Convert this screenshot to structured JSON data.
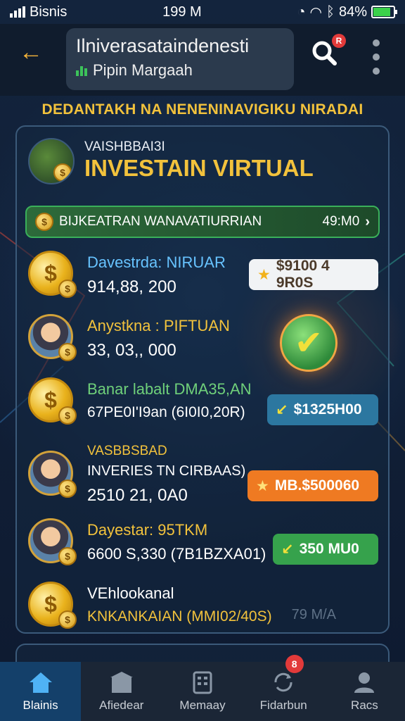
{
  "status_bar": {
    "carrier": "Bisnis",
    "time": "199 M",
    "battery": "84%",
    "battery_level": 0.84
  },
  "header": {
    "title": "Ilniverasataindenesti",
    "subtitle": "Pipin Margaah",
    "search_badge": "R"
  },
  "banner": "DEDANTAKH NA NENENINAVIGIKU NIRADAI",
  "card": {
    "kicker": "VAISHBBAI3I",
    "title": "INVESTAIN VIRTUAL",
    "total_label": "BIJKEATRAN WANAVATIURRIAN",
    "total_value": "49:M0"
  },
  "rows": [
    {
      "line1": "Davestrda: NIRUAR",
      "line1_color": "#67c3ff",
      "line2": "914,88, 200",
      "chip": "$9100 4 9R0S"
    },
    {
      "line1": "Anystkna : PIFTUAN",
      "line1_color": "#f2c23c",
      "line2": "33, 03,, 000"
    },
    {
      "line1": "Banar labalt DMA35,AN",
      "line1_color": "#6fd07a",
      "line2": "67PE0I'I9an (6I0I0,20R)",
      "chip": "$1325H00"
    },
    {
      "kicker": "VASBBSBAD",
      "line1": "INVERIES TN CIRBAAS)",
      "line1_color": "#ffffff",
      "line2": "2510 21, 0A0",
      "chip": "MB.$500060"
    },
    {
      "line1": "Dayestar: 95TKM",
      "line1_color": "#f2c23c",
      "line2": "6600 S,330  (7B1BZXA01)",
      "chip": "350 MU0"
    },
    {
      "line1": "VEhlookanal",
      "line1_color": "#ffffff",
      "line2": "KNKANKAIAN (MMI02/40S)",
      "faded": "79 M/A"
    }
  ],
  "nav": [
    {
      "label": "Blainis",
      "icon": "home-icon"
    },
    {
      "label": "Afiedear",
      "icon": "store-icon"
    },
    {
      "label": "Memaay",
      "icon": "building-icon"
    },
    {
      "label": "Fidarbun",
      "icon": "refresh-icon",
      "badge": "8"
    },
    {
      "label": "Racs",
      "icon": "user-icon"
    }
  ]
}
